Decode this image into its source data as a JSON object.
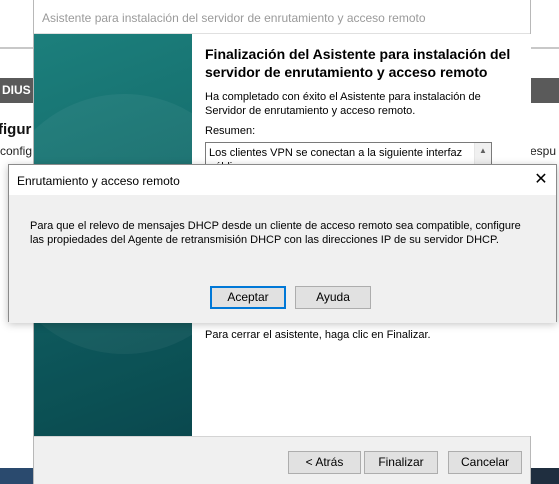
{
  "background": {
    "bar_label": "DIUS (L",
    "heading": "figur",
    "text_left": "config",
    "text_right": "espu"
  },
  "wizard": {
    "title": "Asistente para instalación del servidor de enrutamiento y acceso remoto",
    "heading": "Finalización del Asistente para instalación del servidor de enrutamiento y acceso remoto",
    "intro": "Ha completado con éxito el Asistente para instalación de Servidor de enrutamiento y acceso remoto.",
    "summary_label": "Resumen:",
    "summary_text": "Los clientes VPN se conectan a la siguiente interfaz pública:",
    "finish_text": "Para cerrar el asistente, haga clic en Finalizar.",
    "buttons": {
      "back": "< Atrás",
      "finish": "Finalizar",
      "cancel": "Cancelar"
    }
  },
  "dialog": {
    "title": "Enrutamiento y acceso remoto",
    "message": "Para que el relevo de mensajes DHCP desde un cliente de acceso remoto sea compatible, configure las propiedades del Agente de retransmisión DHCP con las direcciones IP de su servidor DHCP.",
    "close_glyph": "✕",
    "buttons": {
      "ok": "Aceptar",
      "help": "Ayuda"
    }
  },
  "icons": {
    "scroll_up": "▲",
    "close": "close-icon"
  },
  "colors": {
    "banner": "#16706f",
    "focus": "#0078d7",
    "taskbar": "#1f2e3f"
  }
}
